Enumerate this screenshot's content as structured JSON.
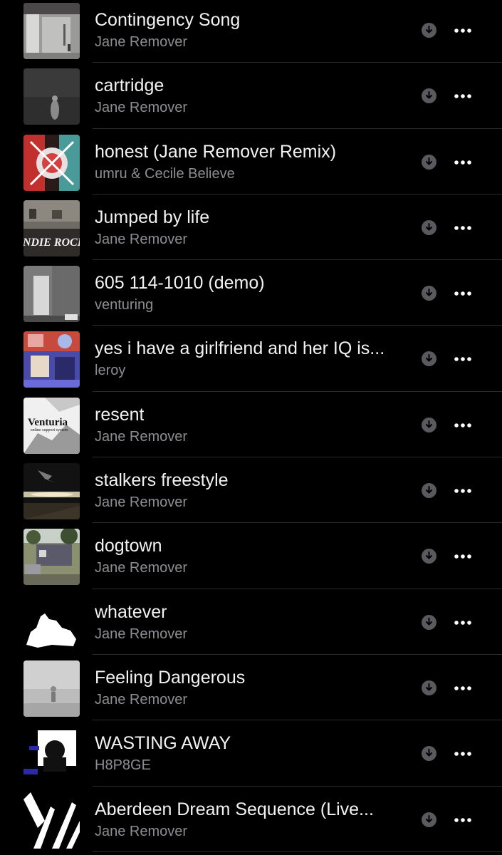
{
  "songs": [
    {
      "title": "Contingency Song",
      "artist": "Jane Remover",
      "artwork_icon": "album-art"
    },
    {
      "title": "cartridge",
      "artist": "Jane Remover",
      "artwork_icon": "album-art"
    },
    {
      "title": "honest (Jane Remover Remix)",
      "artist": "umru & Cecile Believe",
      "artwork_icon": "album-art"
    },
    {
      "title": "Jumped by life",
      "artist": "Jane Remover",
      "artwork_icon": "album-art"
    },
    {
      "title": "605 114-1010 (demo)",
      "artist": "venturing",
      "artwork_icon": "album-art"
    },
    {
      "title": "yes i have a girlfriend and her IQ is...",
      "artist": "leroy",
      "artwork_icon": "album-art"
    },
    {
      "title": "resent",
      "artist": "Jane Remover",
      "artwork_icon": "album-art"
    },
    {
      "title": "stalkers freestyle",
      "artist": "Jane Remover",
      "artwork_icon": "album-art"
    },
    {
      "title": "dogtown",
      "artist": "Jane Remover",
      "artwork_icon": "album-art"
    },
    {
      "title": "whatever",
      "artist": "Jane Remover",
      "artwork_icon": "album-art"
    },
    {
      "title": "Feeling Dangerous",
      "artist": "Jane Remover",
      "artwork_icon": "album-art"
    },
    {
      "title": "WASTING AWAY",
      "artist": "H8P8GE",
      "artwork_icon": "album-art"
    },
    {
      "title": "Aberdeen Dream Sequence (Live...",
      "artist": "Jane Remover",
      "artwork_icon": "album-art"
    }
  ],
  "artwork_text": {
    "jumped_by_life": "INDIE ROCK",
    "resent": "Venturia",
    "resent_sub": "online support system"
  },
  "colors": {
    "background": "#000000",
    "title": "#f2f2f2",
    "subtitle": "#8d8d92",
    "separator": "#2b2b2e",
    "download_icon": "#5a5a5e",
    "more_dots": "#ffffff"
  },
  "icons": {
    "download": "download-icon",
    "more": "more-dots-icon"
  }
}
